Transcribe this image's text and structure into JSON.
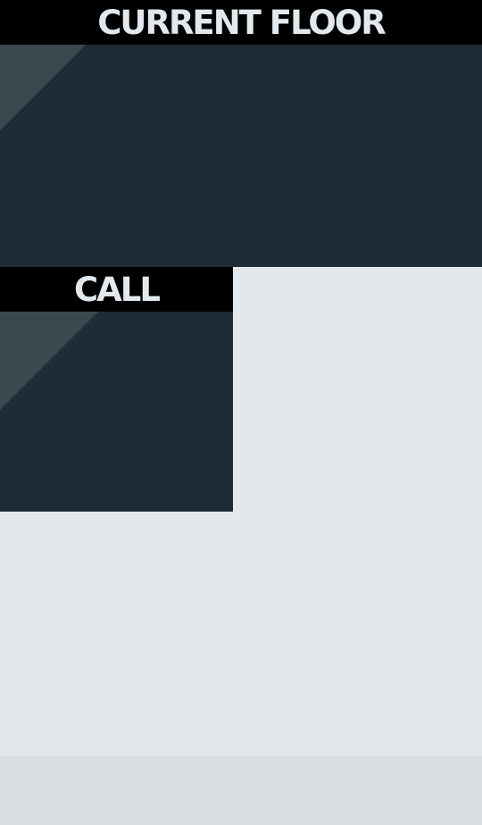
{
  "floor_indicator": {
    "header_label": "CURRENT FLOOR"
  },
  "call_panel": {
    "header_label": "CALL"
  },
  "colors": {
    "background": "#e2e8eb",
    "header_background": "#000000",
    "header_text": "#e2e8eb",
    "display_background": "#1f2b35",
    "glare": "#3c4850",
    "bottom_bar": "#d8dee1"
  }
}
